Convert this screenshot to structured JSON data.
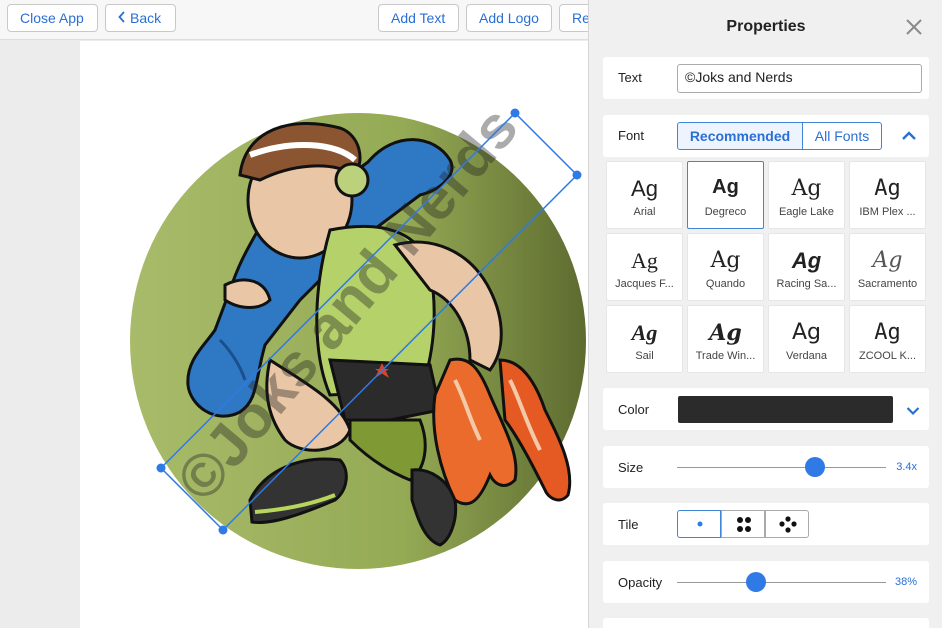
{
  "toolbar": {
    "close_app": "Close App",
    "back": "Back",
    "add_text": "Add Text",
    "add_logo": "Add Logo",
    "partial": "Re"
  },
  "artwork": {
    "watermark": "©Joks and Nerds"
  },
  "panel": {
    "title": "Properties",
    "text": {
      "label": "Text",
      "value": "©Joks and Nerds"
    },
    "font": {
      "label": "Font",
      "tabs": [
        "Recommended",
        "All Fonts"
      ],
      "active_tab": "Recommended",
      "sample": "Ag",
      "fonts": [
        {
          "name": "Arial",
          "selected": false
        },
        {
          "name": "Degreco",
          "selected": true
        },
        {
          "name": "Eagle Lake",
          "selected": false
        },
        {
          "name": "IBM Plex ...",
          "selected": false
        },
        {
          "name": "Jacques F...",
          "selected": false
        },
        {
          "name": "Quando",
          "selected": false
        },
        {
          "name": "Racing Sa...",
          "selected": false
        },
        {
          "name": "Sacramento",
          "selected": false
        },
        {
          "name": "Sail",
          "selected": false
        },
        {
          "name": "Trade Win...",
          "selected": false
        },
        {
          "name": "Verdana",
          "selected": false
        },
        {
          "name": "ZCOOL K...",
          "selected": false
        }
      ]
    },
    "color": {
      "label": "Color",
      "value": "#2b2b2b"
    },
    "size": {
      "label": "Size",
      "value": "3.4x",
      "fraction": 0.66
    },
    "tile": {
      "label": "Tile",
      "options": [
        "single",
        "grid-4",
        "scatter-5"
      ],
      "selected": "single"
    },
    "opacity": {
      "label": "Opacity",
      "value": "38%",
      "fraction": 0.38
    }
  },
  "colors": {
    "accent": "#2f7ae5",
    "accent_text": "#2a6fd6",
    "disc_green": "#9aae5a"
  }
}
